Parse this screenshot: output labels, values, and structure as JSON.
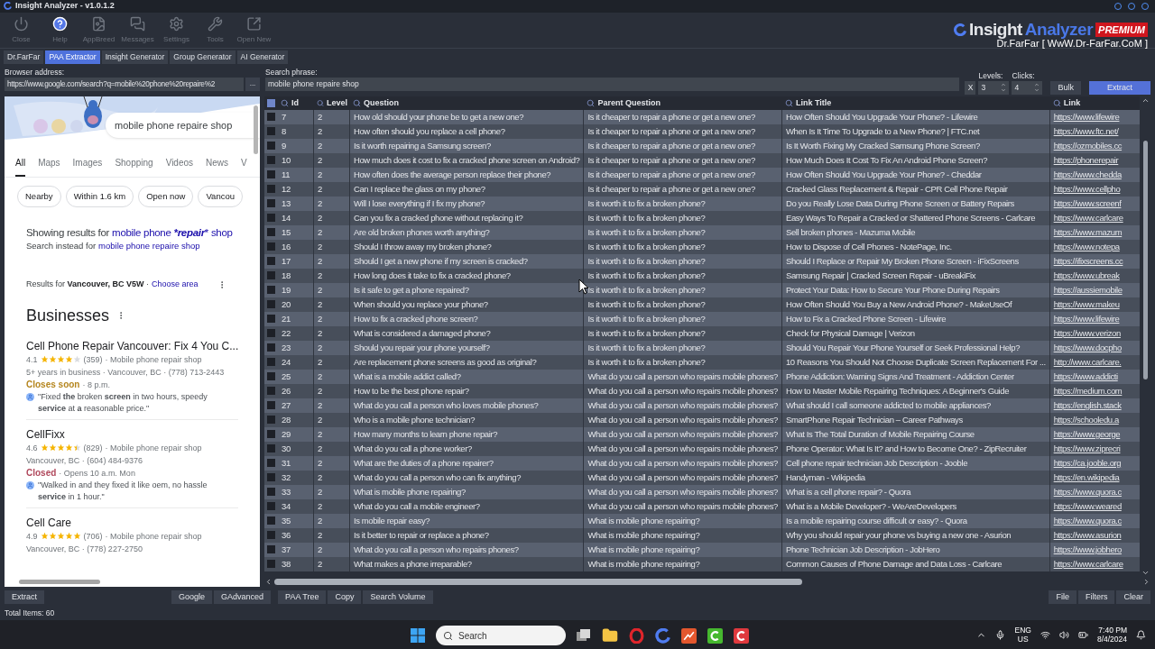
{
  "window": {
    "title": "Insight Analyzer - v1.0.1.2"
  },
  "toolbar": [
    {
      "label": "Close"
    },
    {
      "label": "Help"
    },
    {
      "label": "AppBreed"
    },
    {
      "label": "Messages"
    },
    {
      "label": "Settings"
    },
    {
      "label": "Tools"
    },
    {
      "label": "Open New"
    }
  ],
  "logo": {
    "word1": "Insight",
    "word2": "Analyzer",
    "badge": "PREMIUM",
    "subtitle": "Dr.FarFar [ WwW.Dr-FarFar.CoM ]"
  },
  "tabs": [
    {
      "label": "Dr.FarFar",
      "selected": false
    },
    {
      "label": "PAA Extractor",
      "selected": true
    },
    {
      "label": "Insight Generator",
      "selected": false
    },
    {
      "label": "Group Generator",
      "selected": false
    },
    {
      "label": "AI Generator",
      "selected": false
    }
  ],
  "address": {
    "label": "Browser address:",
    "value": "https://www.google.com/search?q=mobile%20phone%20repaire%2",
    "browse": "..."
  },
  "search": {
    "label": "Search phrase:",
    "value": "mobile phone repaire shop",
    "clear": "X"
  },
  "levels": {
    "label": "Levels:",
    "value": "3"
  },
  "clicks": {
    "label": "Clicks:",
    "value": "4"
  },
  "actions": [
    "Bulk",
    "Extract"
  ],
  "browser": {
    "query": "mobile phone repaire shop",
    "tabs": [
      {
        "label": "All",
        "selected": true
      },
      {
        "label": "Maps",
        "selected": false
      },
      {
        "label": "Images",
        "selected": false
      },
      {
        "label": "Shopping",
        "selected": false
      },
      {
        "label": "Videos",
        "selected": false
      },
      {
        "label": "News",
        "selected": false
      },
      {
        "label": "V",
        "selected": false
      }
    ],
    "chips": [
      "Nearby",
      "Within 1.6 km",
      "Open now",
      "Vancou"
    ],
    "showing": {
      "prefix": "Showing results for",
      "link": "mobile phone ***repair*** shop"
    },
    "instead": {
      "prefix": "Search instead for",
      "link": "mobile phone repaire shop"
    },
    "location": {
      "text": "Results for **Vancouver, BC V5W** ·",
      "link": "Choose area"
    },
    "heading": "Businesses",
    "listings": [
      {
        "name": "Cell Phone Repair Vancouver: Fix 4 You C...",
        "rating": "4.1",
        "stars": 4,
        "reviews": "(359)",
        "category": "· Mobile phone repair shop",
        "details": "5+ years in business · Vancouver, BC · (778) 713-2443",
        "status": {
          "text": "Closes soon",
          "color": "#b5861f"
        },
        "hours": "· 8 p.m.",
        "review": "\"Fixed **the** broken **screen** in two hours, speedy **service** at **a** reasonable price.\""
      },
      {
        "name": "CellFixx",
        "rating": "4.6",
        "stars": 4.5,
        "reviews": "(829)",
        "category": "· Mobile phone repair shop",
        "details": "Vancouver, BC · (604) 484-9376",
        "status": {
          "text": "Closed",
          "color": "#b0485c"
        },
        "hours": "· Opens 10 a.m. Mon",
        "review": "\"Walked in and they fixed it like oem, no hassle **service** in 1 hour.\""
      },
      {
        "name": "Cell Care",
        "rating": "4.9",
        "stars": 5,
        "reviews": "(706)",
        "category": "· Mobile phone repair shop",
        "details": "Vancouver, BC · (778) 227-2750"
      }
    ]
  },
  "table": {
    "all_checked": true,
    "columns": [
      "Id",
      "Level",
      "Question",
      "Parent Question",
      "Link Title",
      "Link"
    ],
    "rows": [
      {
        "id": "7",
        "level": "2",
        "question": "How old should your phone be to get a new one?",
        "parent": "Is it cheaper to repair a phone or get a new one?",
        "title": "How Often Should You Upgrade Your Phone? - Lifewire",
        "link": "https://www.lifewire",
        "checked": false
      },
      {
        "id": "8",
        "level": "2",
        "question": "How often should you replace a cell phone?",
        "parent": "Is it cheaper to repair a phone or get a new one?",
        "title": "When Is It Time To Upgrade to a New Phone? | FTC.net",
        "link": "https://www.ftc.net/",
        "checked": false
      },
      {
        "id": "9",
        "level": "2",
        "question": "Is it worth repairing a Samsung screen?",
        "parent": "Is it cheaper to repair a phone or get a new one?",
        "title": "Is It Worth Fixing My Cracked Samsung Phone Screen?",
        "link": "https://ozmobiles.cc",
        "checked": false
      },
      {
        "id": "10",
        "level": "2",
        "question": "How much does it cost to fix a cracked phone screen on Android?",
        "parent": "Is it cheaper to repair a phone or get a new one?",
        "title": "How Much Does It Cost To Fix An Android Phone Screen?",
        "link": "https://phonerepair",
        "checked": false
      },
      {
        "id": "11",
        "level": "2",
        "question": "How often does the average person replace their phone?",
        "parent": "Is it cheaper to repair a phone or get a new one?",
        "title": "How Often Should You Upgrade Your Phone? - Cheddar",
        "link": "https://www.chedda",
        "checked": false
      },
      {
        "id": "12",
        "level": "2",
        "question": "Can I replace the glass on my phone?",
        "parent": "Is it cheaper to repair a phone or get a new one?",
        "title": "Cracked Glass Replacement & Repair - CPR Cell Phone Repair",
        "link": "https://www.cellpho",
        "checked": false
      },
      {
        "id": "13",
        "level": "2",
        "question": "Will I lose everything if I fix my phone?",
        "parent": "Is it worth it to fix a broken phone?",
        "title": "Do you Really Lose Data During Phone Screen or Battery Repairs",
        "link": "https://www.screenf",
        "checked": false
      },
      {
        "id": "14",
        "level": "2",
        "question": "Can you fix a cracked phone without replacing it?",
        "parent": "Is it worth it to fix a broken phone?",
        "title": "Easy Ways To Repair a Cracked or Shattered Phone Screens - Carlcare",
        "link": "https://www.carlcare",
        "checked": false
      },
      {
        "id": "15",
        "level": "2",
        "question": "Are old broken phones worth anything?",
        "parent": "Is it worth it to fix a broken phone?",
        "title": "Sell broken phones - Mazuma Mobile",
        "link": "https://www.mazum",
        "checked": false
      },
      {
        "id": "16",
        "level": "2",
        "question": "Should I throw away my broken phone?",
        "parent": "Is it worth it to fix a broken phone?",
        "title": "How to Dispose of Cell Phones - NotePage, Inc.",
        "link": "https://www.notepa",
        "checked": false
      },
      {
        "id": "17",
        "level": "2",
        "question": "Should I get a new phone if my screen is cracked?",
        "parent": "Is it worth it to fix a broken phone?",
        "title": "Should I Replace or Repair My Broken Phone Screen - iFixScreens",
        "link": "https://ifixscreens.cc",
        "checked": false
      },
      {
        "id": "18",
        "level": "2",
        "question": "How long does it take to fix a cracked phone?",
        "parent": "Is it worth it to fix a broken phone?",
        "title": "Samsung Repair | Cracked Screen Repair - uBreakiFix",
        "link": "https://www.ubreak",
        "checked": false
      },
      {
        "id": "19",
        "level": "2",
        "question": "Is it safe to get a phone repaired?",
        "parent": "Is it worth it to fix a broken phone?",
        "title": "Protect Your Data: How to Secure Your Phone During Repairs",
        "link": "https://aussiemobile",
        "checked": false
      },
      {
        "id": "20",
        "level": "2",
        "question": "When should you replace your phone?",
        "parent": "Is it worth it to fix a broken phone?",
        "title": "How Often Should You Buy a New Android Phone? - MakeUseOf",
        "link": "https://www.makeu",
        "checked": false
      },
      {
        "id": "21",
        "level": "2",
        "question": "How to fix a cracked phone screen?",
        "parent": "Is it worth it to fix a broken phone?",
        "title": "How to Fix a Cracked Phone Screen - Lifewire",
        "link": "https://www.lifewire",
        "checked": false
      },
      {
        "id": "22",
        "level": "2",
        "question": "What is considered a damaged phone?",
        "parent": "Is it worth it to fix a broken phone?",
        "title": "Check for Physical Damage | Verizon",
        "link": "https://www.verizon",
        "checked": false
      },
      {
        "id": "23",
        "level": "2",
        "question": "Should you repair your phone yourself?",
        "parent": "Is it worth it to fix a broken phone?",
        "title": "Should You Repair Your Phone Yourself or Seek Professional Help?",
        "link": "https://www.docpho",
        "checked": false
      },
      {
        "id": "24",
        "level": "2",
        "question": "Are replacement phone screens as good as original?",
        "parent": "Is it worth it to fix a broken phone?",
        "title": "10 Reasons You Should Not Choose Duplicate Screen Replacement For ...",
        "link": "http://www.carlcare.",
        "checked": false
      },
      {
        "id": "25",
        "level": "2",
        "question": "What is a mobile addict called?",
        "parent": "What do you call a person who repairs mobile phones?",
        "title": "Phone Addiction: Warning Signs And Treatment - Addiction Center",
        "link": "https://www.addicti",
        "checked": false
      },
      {
        "id": "26",
        "level": "2",
        "question": "How to be the best phone repair?",
        "parent": "What do you call a person who repairs mobile phones?",
        "title": "How to Master Mobile Repairing Techniques: A Beginner's Guide",
        "link": "https://medium.com",
        "checked": false
      },
      {
        "id": "27",
        "level": "2",
        "question": "What do you call a person who loves mobile phones?",
        "parent": "What do you call a person who repairs mobile phones?",
        "title": "What should I call someone addicted to mobile appliances?",
        "link": "https://english.stack",
        "checked": false
      },
      {
        "id": "28",
        "level": "2",
        "question": "Who is a mobile phone technician?",
        "parent": "What do you call a person who repairs mobile phones?",
        "title": "SmartPhone Repair Technician – Career Pathways",
        "link": "https://schooledu.a",
        "checked": false
      },
      {
        "id": "29",
        "level": "2",
        "question": "How many months to learn phone repair?",
        "parent": "What do you call a person who repairs mobile phones?",
        "title": "What Is The Total Duration of Mobile Repairing Course",
        "link": "https://www.george",
        "checked": false
      },
      {
        "id": "30",
        "level": "2",
        "question": "What do you call a phone worker?",
        "parent": "What do you call a person who repairs mobile phones?",
        "title": "Phone Operator: What Is It? and How to Become One? - ZipRecruiter",
        "link": "https://www.ziprecri",
        "checked": false
      },
      {
        "id": "31",
        "level": "2",
        "question": "What are the duties of a phone repairer?",
        "parent": "What do you call a person who repairs mobile phones?",
        "title": "Cell phone repair technician Job Description - Jooble",
        "link": "https://ca.jooble.org",
        "checked": false
      },
      {
        "id": "32",
        "level": "2",
        "question": "What do you call a person who can fix anything?",
        "parent": "What do you call a person who repairs mobile phones?",
        "title": "Handyman - Wikipedia",
        "link": "https://en.wikipedia",
        "checked": false
      },
      {
        "id": "33",
        "level": "2",
        "question": "What is mobile phone repairing?",
        "parent": "What do you call a person who repairs mobile phones?",
        "title": "What is a cell phone repair? - Quora",
        "link": "https://www.quora.c",
        "checked": false
      },
      {
        "id": "34",
        "level": "2",
        "question": "What do you call a mobile engineer?",
        "parent": "What do you call a person who repairs mobile phones?",
        "title": "What is a Mobile Developer? - WeAreDevelopers",
        "link": "https://www.weared",
        "checked": false
      },
      {
        "id": "35",
        "level": "2",
        "question": "Is mobile repair easy?",
        "parent": "What is mobile phone repairing?",
        "title": "Is a mobile repairing course difficult or easy? - Quora",
        "link": "https://www.quora.c",
        "checked": false
      },
      {
        "id": "36",
        "level": "2",
        "question": "Is it better to repair or replace a phone?",
        "parent": "What is mobile phone repairing?",
        "title": "Why you should repair your phone vs buying a new one - Asurion",
        "link": "https://www.asurion",
        "checked": false
      },
      {
        "id": "37",
        "level": "2",
        "question": "What do you call a person who repairs phones?",
        "parent": "What is mobile phone repairing?",
        "title": "Phone Technician Job Description - JobHero",
        "link": "https://www.jobhero",
        "checked": false
      },
      {
        "id": "38",
        "level": "2",
        "question": "What makes a phone irreparable?",
        "parent": "What is mobile phone repairing?",
        "title": "Common Causes of Phone Damage and Data Loss - Carlcare",
        "link": "https://www.carlcare",
        "checked": false
      }
    ]
  },
  "bottom_left": [
    "Extract",
    "Google",
    "GAdvanced"
  ],
  "bottom_mid": [
    "PAA Tree",
    "Copy",
    "Search Volume"
  ],
  "bottom_right": [
    "File",
    "Filters",
    "Clear"
  ],
  "status_bar": "Total Items: 60",
  "taskbar": {
    "search": "Search",
    "lang1": "ENG",
    "lang2": "US",
    "time": "7:40 PM",
    "date": "8/4/2024"
  }
}
